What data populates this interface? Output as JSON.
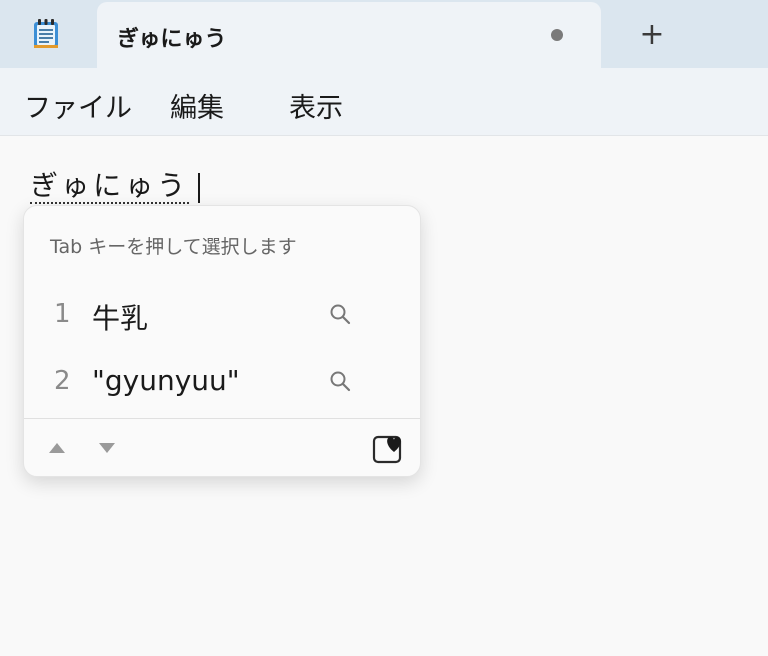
{
  "window": {
    "tab_title": "ぎゅにゅう",
    "new_tab_label": "+"
  },
  "menu": {
    "items": [
      "ファイル",
      "編集",
      "表示"
    ]
  },
  "editor": {
    "composing_text": "ぎゅにゅう"
  },
  "ime": {
    "hint": "Tab キーを押して選択します",
    "candidates": [
      {
        "number": "1",
        "text": "牛乳"
      },
      {
        "number": "2",
        "text": "\"gyunyuu\""
      }
    ],
    "icons": {
      "search": "search-icon",
      "prev": "triangle-up-icon",
      "next": "triangle-down-icon",
      "favorite": "favorite-heart-icon"
    }
  },
  "colors": {
    "titlebar": "#dbe6ef",
    "tab_bg": "#eff3f7",
    "editor_bg": "#f9f9f9"
  }
}
